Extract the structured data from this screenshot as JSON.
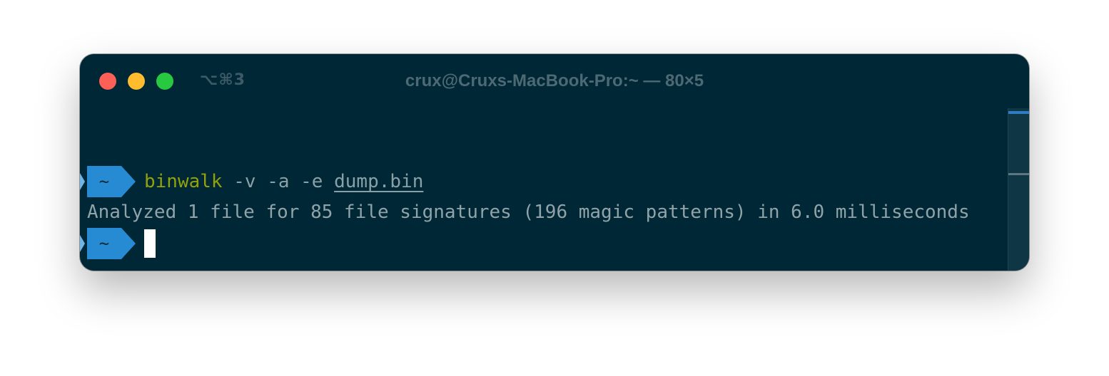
{
  "window": {
    "title": "crux@Cruxs-MacBook-Pro:~ — 80×5",
    "shortcut": "⌥⌘3"
  },
  "traffic_lights": {
    "close_color": "#fe5f57",
    "minimize_color": "#febc2e",
    "zoom_color": "#28c840"
  },
  "terminal": {
    "background": "#002735",
    "prompt_symbol": "~",
    "prompt_color": "#268bd2",
    "command": {
      "name": "binwalk",
      "args": " -v -a -e ",
      "file": "dump.bin"
    },
    "output": "Analyzed 1 file for 85 file signatures (196 magic patterns) in 6.0 milliseconds",
    "second_prompt_symbol": "~"
  }
}
